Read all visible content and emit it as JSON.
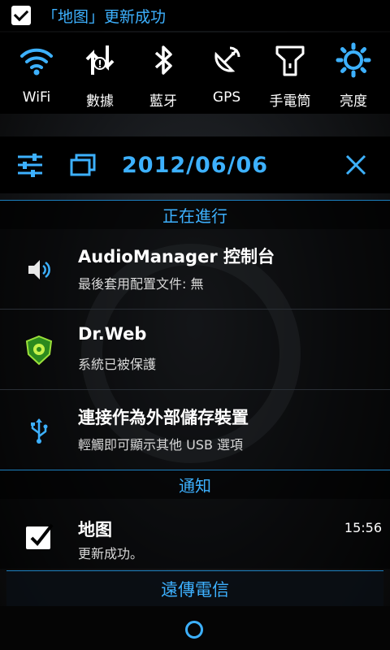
{
  "status_bar": {
    "message": "「地图」更新成功"
  },
  "toggles": [
    {
      "icon": "wifi-icon",
      "label": "WiFi"
    },
    {
      "icon": "data-icon",
      "label": "數據"
    },
    {
      "icon": "bluetooth-icon",
      "label": "藍牙"
    },
    {
      "icon": "gps-icon",
      "label": "GPS"
    },
    {
      "icon": "flashlight-icon",
      "label": "手電筒"
    },
    {
      "icon": "brightness-icon",
      "label": "亮度"
    }
  ],
  "date_row": {
    "date": "2012/06/06"
  },
  "ongoing": {
    "header": "正在進行",
    "items": [
      {
        "icon": "speaker-icon",
        "title": "AudioManager 控制台",
        "subtitle": "最後套用配置文件: 無"
      },
      {
        "icon": "drweb-shield-icon",
        "title": "Dr.Web",
        "subtitle": "系統已被保護"
      },
      {
        "icon": "usb-icon",
        "title": "連接作為外部儲存裝置",
        "subtitle": "輕觸即可顯示其他 USB 選項"
      }
    ]
  },
  "notifications": {
    "header": "通知",
    "items": [
      {
        "icon": "check-icon",
        "title": "地图",
        "subtitle": "更新成功。",
        "time": "15:56"
      }
    ]
  },
  "carrier": {
    "label": "遠傳電信"
  },
  "accent_color": "#3db1ff"
}
